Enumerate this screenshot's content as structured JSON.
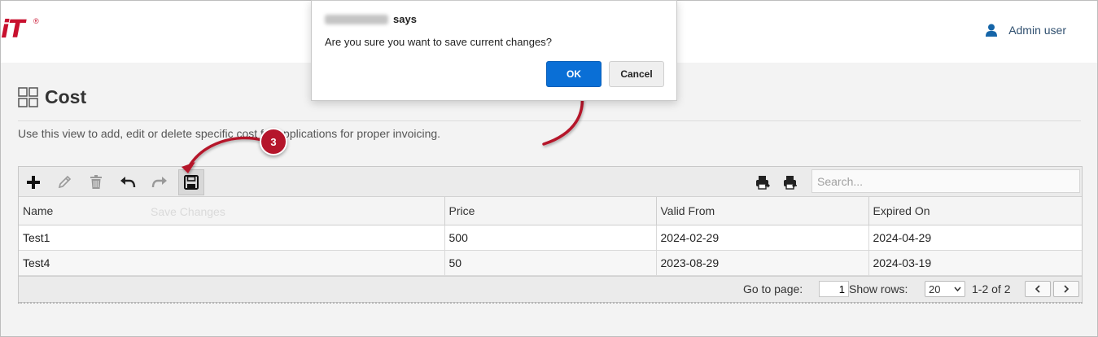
{
  "header": {
    "logo_text": "iT",
    "logo_mark": "®",
    "user_icon": "user-icon",
    "user_name": "Admin user"
  },
  "page": {
    "title": "Cost",
    "title_icon": "grid-icon",
    "description": "Use this view to add, edit or delete specific cost for applications for proper invoicing."
  },
  "toolbar": {
    "buttons": [
      {
        "name": "add",
        "icon": "plus-icon"
      },
      {
        "name": "edit",
        "icon": "pencil-icon"
      },
      {
        "name": "delete",
        "icon": "trash-icon"
      },
      {
        "name": "undo",
        "icon": "undo-icon"
      },
      {
        "name": "redo",
        "icon": "redo-icon"
      },
      {
        "name": "save",
        "icon": "save-icon",
        "active": true
      }
    ],
    "save_tooltip": "Save Changes",
    "export_icons": [
      "print-export-icon",
      "print-import-icon"
    ],
    "search_placeholder": "Search..."
  },
  "table": {
    "columns": [
      "Name",
      "Price",
      "Valid From",
      "Expired On"
    ],
    "rows": [
      {
        "name": "Test1",
        "price": "500",
        "valid_from": "2024-02-29",
        "expired_on": "2024-04-29"
      },
      {
        "name": "Test4",
        "price": "50",
        "valid_from": "2023-08-29",
        "expired_on": "2024-03-19"
      }
    ]
  },
  "pager": {
    "go_to_page_label": "Go to page:",
    "page_value": "1",
    "show_rows_label": "Show rows:",
    "rows_value": "20",
    "range_text": "1-2 of 2"
  },
  "callout": {
    "step_number": "3",
    "accent_color": "#b5162b"
  },
  "dialog": {
    "title_suffix": "says",
    "message": "Are you sure you want to save current changes?",
    "ok_label": "OK",
    "cancel_label": "Cancel",
    "ok_color": "#0a6fd6"
  }
}
